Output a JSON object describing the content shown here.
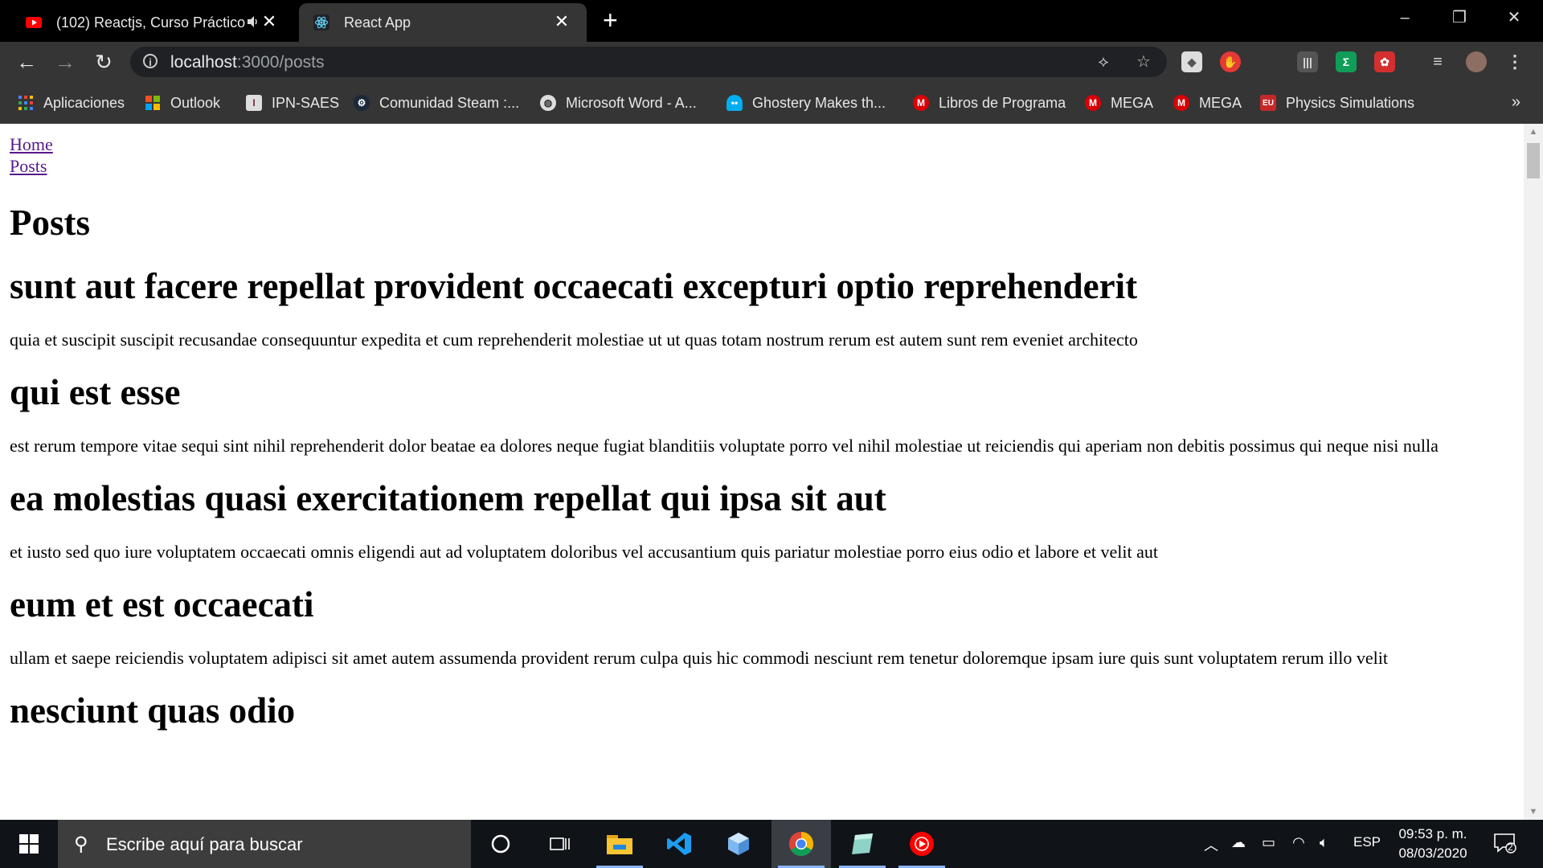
{
  "browser": {
    "tabs": [
      {
        "title": "(102) Reactjs, Curso Práctico",
        "icon": "youtube-icon",
        "audio": true,
        "active": false
      },
      {
        "title": "React App",
        "icon": "react-icon",
        "active": true
      }
    ],
    "url": {
      "host": "localhost",
      "path": ":3000/posts"
    },
    "bookmarks": [
      {
        "label": "Aplicaciones",
        "icon": "apps-grid-icon"
      },
      {
        "label": "Outlook",
        "icon": "microsoft-icon"
      },
      {
        "label": "IPN-SAES",
        "icon": "ipn-icon"
      },
      {
        "label": "Comunidad Steam :...",
        "icon": "steam-icon"
      },
      {
        "label": "Microsoft Word - A...",
        "icon": "globe-icon"
      },
      {
        "label": "Ghostery Makes th...",
        "icon": "ghostery-icon"
      },
      {
        "label": "Libros de Programa",
        "icon": "mega-icon"
      },
      {
        "label": "MEGA",
        "icon": "mega-icon"
      },
      {
        "label": "MEGA",
        "icon": "mega-icon"
      },
      {
        "label": "Physics Simulations",
        "icon": "eu-icon"
      }
    ]
  },
  "page": {
    "nav": [
      "Home",
      "Posts"
    ],
    "heading": "Posts",
    "posts": [
      {
        "title": "sunt aut facere repellat provident occaecati excepturi optio reprehenderit",
        "body": "quia et suscipit suscipit recusandae consequuntur expedita et cum reprehenderit molestiae ut ut quas totam nostrum rerum est autem sunt rem eveniet architecto"
      },
      {
        "title": "qui est esse",
        "body": "est rerum tempore vitae sequi sint nihil reprehenderit dolor beatae ea dolores neque fugiat blanditiis voluptate porro vel nihil molestiae ut reiciendis qui aperiam non debitis possimus qui neque nisi nulla"
      },
      {
        "title": "ea molestias quasi exercitationem repellat qui ipsa sit aut",
        "body": "et iusto sed quo iure voluptatem occaecati omnis eligendi aut ad voluptatem doloribus vel accusantium quis pariatur molestiae porro eius odio et labore et velit aut"
      },
      {
        "title": "eum et est occaecati",
        "body": "ullam et saepe reiciendis voluptatem adipisci sit amet autem assumenda provident rerum culpa quis hic commodi nesciunt rem tenetur doloremque ipsam iure quis sunt voluptatem rerum illo velit"
      },
      {
        "title": "nesciunt quas odio",
        "body": ""
      }
    ]
  },
  "taskbar": {
    "search_placeholder": "Escribe aquí para buscar",
    "language": "ESP",
    "time": "09:53 p. m.",
    "date": "08/03/2020",
    "notifications": "2"
  }
}
